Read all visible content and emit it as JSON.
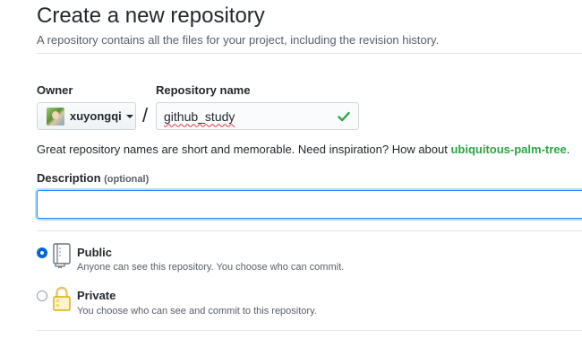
{
  "header": {
    "title": "Create a new repository",
    "subtitle": "A repository contains all the files for your project, including the revision history."
  },
  "owner": {
    "label": "Owner",
    "value": "xuyongqi"
  },
  "separator": "/",
  "repository": {
    "label": "Repository name",
    "value": "github_study",
    "valid": true
  },
  "hint": {
    "text": "Great repository names are short and memorable. Need inspiration? How about ",
    "suggestion": "ubiquitous-palm-tree",
    "end": "."
  },
  "description": {
    "label": "Description",
    "optional": "(optional)",
    "value": ""
  },
  "visibility": {
    "selected": "public",
    "options": [
      {
        "id": "public",
        "title": "Public",
        "desc": "Anyone can see this repository. You choose who can commit."
      },
      {
        "id": "private",
        "title": "Private",
        "desc": "You choose who can see and commit to this repository."
      }
    ]
  },
  "colors": {
    "accent": "#0366d6",
    "success": "#28a745",
    "text": "#24292e",
    "muted": "#586069"
  },
  "icons": [
    "repo-icon",
    "lock-icon",
    "check-icon",
    "chevron-down-icon",
    "avatar"
  ]
}
